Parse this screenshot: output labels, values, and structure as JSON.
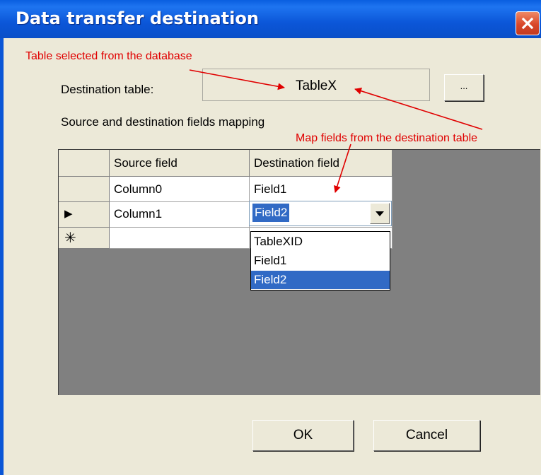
{
  "window": {
    "title": "Data transfer destination"
  },
  "annotations": {
    "table_note": "Table selected from the database",
    "map_note": "Map fields from the destination table"
  },
  "destination": {
    "label": "Destination table:",
    "value": "TableX",
    "browse_label": "..."
  },
  "mapping_label": "Source and destination fields mapping",
  "grid": {
    "columns": [
      "Source field",
      "Destination field"
    ],
    "rows": [
      {
        "indicator": "",
        "source": "Column0",
        "destination": "Field1"
      },
      {
        "indicator": "▶",
        "source": "Column1",
        "destination": "Field2"
      },
      {
        "indicator": "✳",
        "source": "",
        "destination": ""
      }
    ]
  },
  "dropdown": {
    "selected": "Field2",
    "options": [
      "TableXID",
      "Field1",
      "Field2"
    ],
    "highlighted": "Field2"
  },
  "buttons": {
    "ok": "OK",
    "cancel": "Cancel"
  },
  "colors": {
    "title_bar": "#0a5fe0",
    "annotation": "#e00000",
    "selection": "#316ac5",
    "dialog_bg": "#ece9d8"
  },
  "icons": {
    "close": "close-icon",
    "row_pointer": "row-pointer-icon",
    "new_row": "new-row-icon",
    "dropdown": "chevron-down-icon"
  }
}
